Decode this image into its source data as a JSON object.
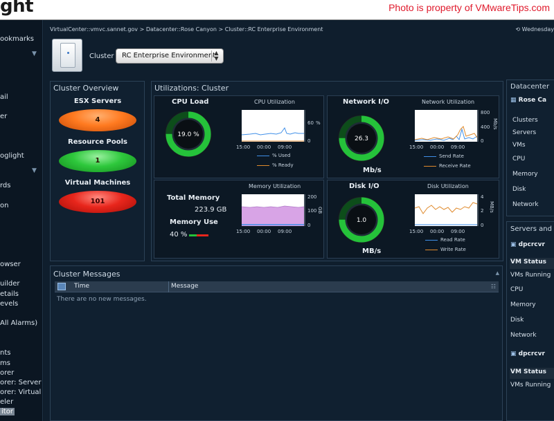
{
  "header": {
    "logo_text": "ght",
    "watermark": "Photo is property of VMwareTips.com"
  },
  "leftnav": {
    "items": [
      {
        "label": "ookmarks"
      },
      {
        "label": "ail"
      },
      {
        "label": "er"
      },
      {
        "label": "oglight"
      },
      {
        "label": "rds"
      },
      {
        "label": "on"
      },
      {
        "label": "owser"
      },
      {
        "label": "uilder"
      },
      {
        "label": "etails"
      },
      {
        "label": "evels"
      },
      {
        "label": "All Alarms)"
      },
      {
        "label": "nts"
      },
      {
        "label": "ms"
      },
      {
        "label": "orer"
      },
      {
        "label": "orer: Server"
      },
      {
        "label": "orer: Virtual I"
      },
      {
        "label": "eler"
      },
      {
        "label": "itor"
      }
    ]
  },
  "breadcrumb": "VirtualCenter::vmvc.sannet.gov > Datacenter::Rose Canyon > Cluster::RC Enterprise Environment",
  "date_prefix": "Wednesday",
  "cluster": {
    "label": "Cluster",
    "selected": "RC Enterprise Environment"
  },
  "overview": {
    "title": "Cluster Overview",
    "items": [
      {
        "label": "ESX Servers",
        "value": "4",
        "color": "#ff7a20"
      },
      {
        "label": "Resource Pools",
        "value": "1",
        "color": "#2ec83c"
      },
      {
        "label": "Virtual Machines",
        "value": "101",
        "color": "#e8261c"
      }
    ]
  },
  "utilizations": {
    "title": "Utilizations: Cluster",
    "cpu": {
      "title": "CPU Load",
      "gauge_value": "19.0 %",
      "gauge_fraction": 0.19,
      "chart_title": "CPU Utilization",
      "y_ticks": [
        "60",
        "%",
        "0"
      ],
      "x_ticks": [
        "15:00",
        "00:00",
        "09:00"
      ],
      "legend": [
        "% Used",
        "% Ready"
      ]
    },
    "network": {
      "title": "Network I/O",
      "gauge_value": "26.3",
      "unit": "Mb/s",
      "gauge_fraction": 0.33,
      "chart_title": "Network Utilization",
      "y_ticks": [
        "800",
        "400",
        "0"
      ],
      "y_unit": "Mb/s",
      "x_ticks": [
        "15:00",
        "00:00",
        "09:00"
      ],
      "legend": [
        "Send Rate",
        "Receive Rate"
      ]
    },
    "memory": {
      "total_label": "Total Memory",
      "total_value": "223.9 GB",
      "use_label": "Memory Use",
      "use_value": "40 %",
      "chart_title": "Memory Utilization",
      "y_ticks": [
        "200",
        "100",
        "0"
      ],
      "y_unit": "GB",
      "x_ticks": [
        "15:00",
        "00:00",
        "09:00"
      ]
    },
    "disk": {
      "title": "Disk I/O",
      "gauge_value": "1.0",
      "unit": "MB/s",
      "gauge_fraction": 0.25,
      "chart_title": "Disk Utilization",
      "y_ticks": [
        "4",
        "2",
        "0"
      ],
      "y_unit": "MB/s",
      "x_ticks": [
        "15:00",
        "00:00",
        "09:00"
      ],
      "legend": [
        "Read Rate",
        "Write Rate"
      ]
    },
    "colors": {
      "used": "#3f8fe8",
      "ready": "#e08a2c",
      "gauge": "#25c23a"
    }
  },
  "messages": {
    "title": "Cluster Messages",
    "col_time": "Time",
    "col_message": "Message",
    "empty": "There are no new messages."
  },
  "datacenter": {
    "title": "Datacenter",
    "name": "Rose Ca",
    "rows": [
      "Clusters",
      "Servers",
      "VMs",
      "CPU",
      "Memory",
      "Disk",
      "Network"
    ]
  },
  "servers": {
    "title": "Servers and",
    "host1": "dpcrcvr",
    "host2": "dpcrcvr",
    "status_label": "VM Status",
    "rows": [
      "VMs Running",
      "CPU",
      "Memory",
      "Disk",
      "Network"
    ]
  }
}
